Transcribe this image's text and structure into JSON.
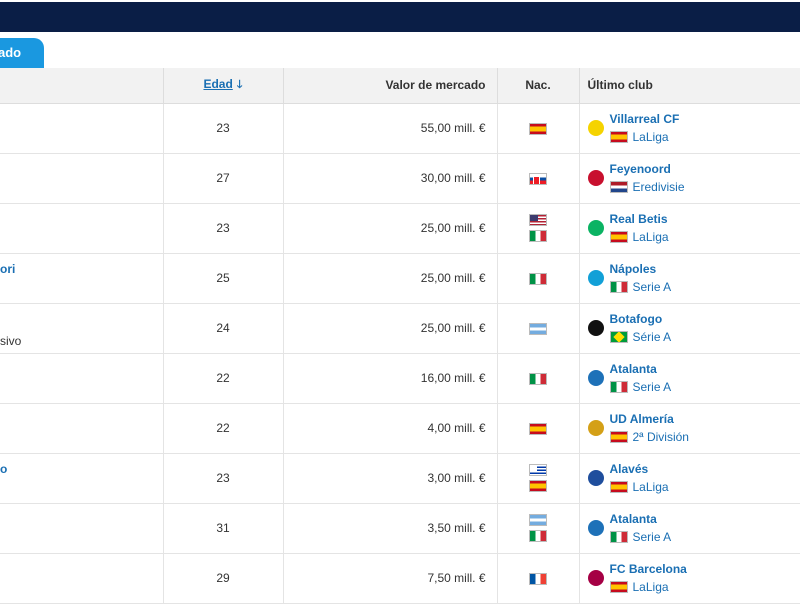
{
  "tab": {
    "label": "ado"
  },
  "headers": {
    "age": "Edad",
    "value": "Valor de mercado",
    "nat": "Nac.",
    "club": "Último club"
  },
  "rows": [
    {
      "name": "",
      "sub": "",
      "age": "23",
      "value": "55,00 mill. €",
      "flags": [
        "f-es"
      ],
      "club": "Villarreal CF",
      "league": "LaLiga",
      "league_flag": "f-es",
      "crest": "#f5d300"
    },
    {
      "name": "",
      "sub": "",
      "age": "27",
      "value": "30,00 mill. €",
      "flags": [
        "f-sk"
      ],
      "club": "Feyenoord",
      "league": "Eredivisie",
      "league_flag": "f-nl",
      "crest": "#c8102e"
    },
    {
      "name": "",
      "sub": "",
      "age": "23",
      "value": "25,00 mill. €",
      "flags": [
        "f-us",
        "f-it"
      ],
      "club": "Real Betis",
      "league": "LaLiga",
      "league_flag": "f-es",
      "crest": "#0bb363"
    },
    {
      "name": "ori",
      "sub": "",
      "age": "25",
      "value": "25,00 mill. €",
      "flags": [
        "f-it"
      ],
      "club": "Nápoles",
      "league": "Serie A",
      "league_flag": "f-it",
      "crest": "#12a0d7"
    },
    {
      "name": "",
      "sub": "sivo",
      "age": "24",
      "value": "25,00 mill. €",
      "flags": [
        "f-ar"
      ],
      "club": "Botafogo",
      "league": "Série A",
      "league_flag": "f-br",
      "crest": "#111111"
    },
    {
      "name": "",
      "sub": "",
      "age": "22",
      "value": "16,00 mill. €",
      "flags": [
        "f-it"
      ],
      "club": "Atalanta",
      "league": "Serie A",
      "league_flag": "f-it",
      "crest": "#1e71b8"
    },
    {
      "name": "",
      "sub": "",
      "age": "22",
      "value": "4,00 mill. €",
      "flags": [
        "f-es"
      ],
      "club": "UD Almería",
      "league": "2ª División",
      "league_flag": "f-es",
      "crest": "#d4a017"
    },
    {
      "name": "o",
      "sub": "",
      "age": "23",
      "value": "3,00 mill. €",
      "flags": [
        "f-uy",
        "f-es"
      ],
      "club": "Alavés",
      "league": "LaLiga",
      "league_flag": "f-es",
      "crest": "#1f4e9d"
    },
    {
      "name": "",
      "sub": "",
      "age": "31",
      "value": "3,50 mill. €",
      "flags": [
        "f-ar",
        "f-it"
      ],
      "club": "Atalanta",
      "league": "Serie A",
      "league_flag": "f-it",
      "crest": "#1e71b8"
    },
    {
      "name": "",
      "sub": "",
      "age": "29",
      "value": "7,50 mill. €",
      "flags": [
        "f-fr"
      ],
      "club": "FC Barcelona",
      "league": "LaLiga",
      "league_flag": "f-es",
      "crest": "#a50044"
    }
  ]
}
